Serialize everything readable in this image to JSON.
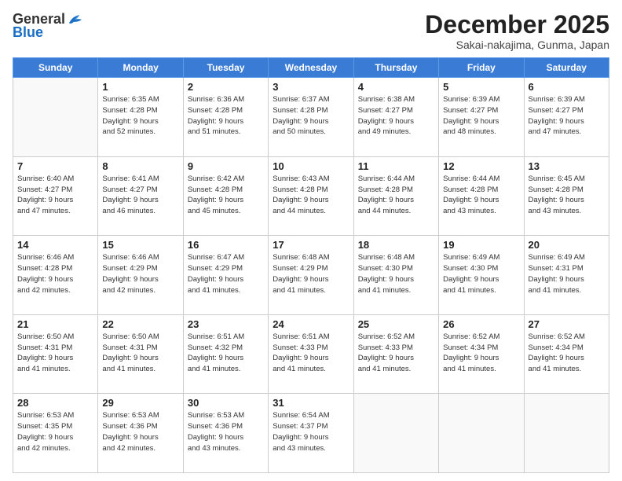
{
  "logo": {
    "general": "General",
    "blue": "Blue"
  },
  "header": {
    "month": "December 2025",
    "location": "Sakai-nakajima, Gunma, Japan"
  },
  "weekdays": [
    "Sunday",
    "Monday",
    "Tuesday",
    "Wednesday",
    "Thursday",
    "Friday",
    "Saturday"
  ],
  "weeks": [
    [
      {
        "day": "",
        "info": ""
      },
      {
        "day": "1",
        "info": "Sunrise: 6:35 AM\nSunset: 4:28 PM\nDaylight: 9 hours\nand 52 minutes."
      },
      {
        "day": "2",
        "info": "Sunrise: 6:36 AM\nSunset: 4:28 PM\nDaylight: 9 hours\nand 51 minutes."
      },
      {
        "day": "3",
        "info": "Sunrise: 6:37 AM\nSunset: 4:28 PM\nDaylight: 9 hours\nand 50 minutes."
      },
      {
        "day": "4",
        "info": "Sunrise: 6:38 AM\nSunset: 4:27 PM\nDaylight: 9 hours\nand 49 minutes."
      },
      {
        "day": "5",
        "info": "Sunrise: 6:39 AM\nSunset: 4:27 PM\nDaylight: 9 hours\nand 48 minutes."
      },
      {
        "day": "6",
        "info": "Sunrise: 6:39 AM\nSunset: 4:27 PM\nDaylight: 9 hours\nand 47 minutes."
      }
    ],
    [
      {
        "day": "7",
        "info": "Sunrise: 6:40 AM\nSunset: 4:27 PM\nDaylight: 9 hours\nand 47 minutes."
      },
      {
        "day": "8",
        "info": "Sunrise: 6:41 AM\nSunset: 4:27 PM\nDaylight: 9 hours\nand 46 minutes."
      },
      {
        "day": "9",
        "info": "Sunrise: 6:42 AM\nSunset: 4:28 PM\nDaylight: 9 hours\nand 45 minutes."
      },
      {
        "day": "10",
        "info": "Sunrise: 6:43 AM\nSunset: 4:28 PM\nDaylight: 9 hours\nand 44 minutes."
      },
      {
        "day": "11",
        "info": "Sunrise: 6:44 AM\nSunset: 4:28 PM\nDaylight: 9 hours\nand 44 minutes."
      },
      {
        "day": "12",
        "info": "Sunrise: 6:44 AM\nSunset: 4:28 PM\nDaylight: 9 hours\nand 43 minutes."
      },
      {
        "day": "13",
        "info": "Sunrise: 6:45 AM\nSunset: 4:28 PM\nDaylight: 9 hours\nand 43 minutes."
      }
    ],
    [
      {
        "day": "14",
        "info": "Sunrise: 6:46 AM\nSunset: 4:28 PM\nDaylight: 9 hours\nand 42 minutes."
      },
      {
        "day": "15",
        "info": "Sunrise: 6:46 AM\nSunset: 4:29 PM\nDaylight: 9 hours\nand 42 minutes."
      },
      {
        "day": "16",
        "info": "Sunrise: 6:47 AM\nSunset: 4:29 PM\nDaylight: 9 hours\nand 41 minutes."
      },
      {
        "day": "17",
        "info": "Sunrise: 6:48 AM\nSunset: 4:29 PM\nDaylight: 9 hours\nand 41 minutes."
      },
      {
        "day": "18",
        "info": "Sunrise: 6:48 AM\nSunset: 4:30 PM\nDaylight: 9 hours\nand 41 minutes."
      },
      {
        "day": "19",
        "info": "Sunrise: 6:49 AM\nSunset: 4:30 PM\nDaylight: 9 hours\nand 41 minutes."
      },
      {
        "day": "20",
        "info": "Sunrise: 6:49 AM\nSunset: 4:31 PM\nDaylight: 9 hours\nand 41 minutes."
      }
    ],
    [
      {
        "day": "21",
        "info": "Sunrise: 6:50 AM\nSunset: 4:31 PM\nDaylight: 9 hours\nand 41 minutes."
      },
      {
        "day": "22",
        "info": "Sunrise: 6:50 AM\nSunset: 4:31 PM\nDaylight: 9 hours\nand 41 minutes."
      },
      {
        "day": "23",
        "info": "Sunrise: 6:51 AM\nSunset: 4:32 PM\nDaylight: 9 hours\nand 41 minutes."
      },
      {
        "day": "24",
        "info": "Sunrise: 6:51 AM\nSunset: 4:33 PM\nDaylight: 9 hours\nand 41 minutes."
      },
      {
        "day": "25",
        "info": "Sunrise: 6:52 AM\nSunset: 4:33 PM\nDaylight: 9 hours\nand 41 minutes."
      },
      {
        "day": "26",
        "info": "Sunrise: 6:52 AM\nSunset: 4:34 PM\nDaylight: 9 hours\nand 41 minutes."
      },
      {
        "day": "27",
        "info": "Sunrise: 6:52 AM\nSunset: 4:34 PM\nDaylight: 9 hours\nand 41 minutes."
      }
    ],
    [
      {
        "day": "28",
        "info": "Sunrise: 6:53 AM\nSunset: 4:35 PM\nDaylight: 9 hours\nand 42 minutes."
      },
      {
        "day": "29",
        "info": "Sunrise: 6:53 AM\nSunset: 4:36 PM\nDaylight: 9 hours\nand 42 minutes."
      },
      {
        "day": "30",
        "info": "Sunrise: 6:53 AM\nSunset: 4:36 PM\nDaylight: 9 hours\nand 43 minutes."
      },
      {
        "day": "31",
        "info": "Sunrise: 6:54 AM\nSunset: 4:37 PM\nDaylight: 9 hours\nand 43 minutes."
      },
      {
        "day": "",
        "info": ""
      },
      {
        "day": "",
        "info": ""
      },
      {
        "day": "",
        "info": ""
      }
    ]
  ]
}
